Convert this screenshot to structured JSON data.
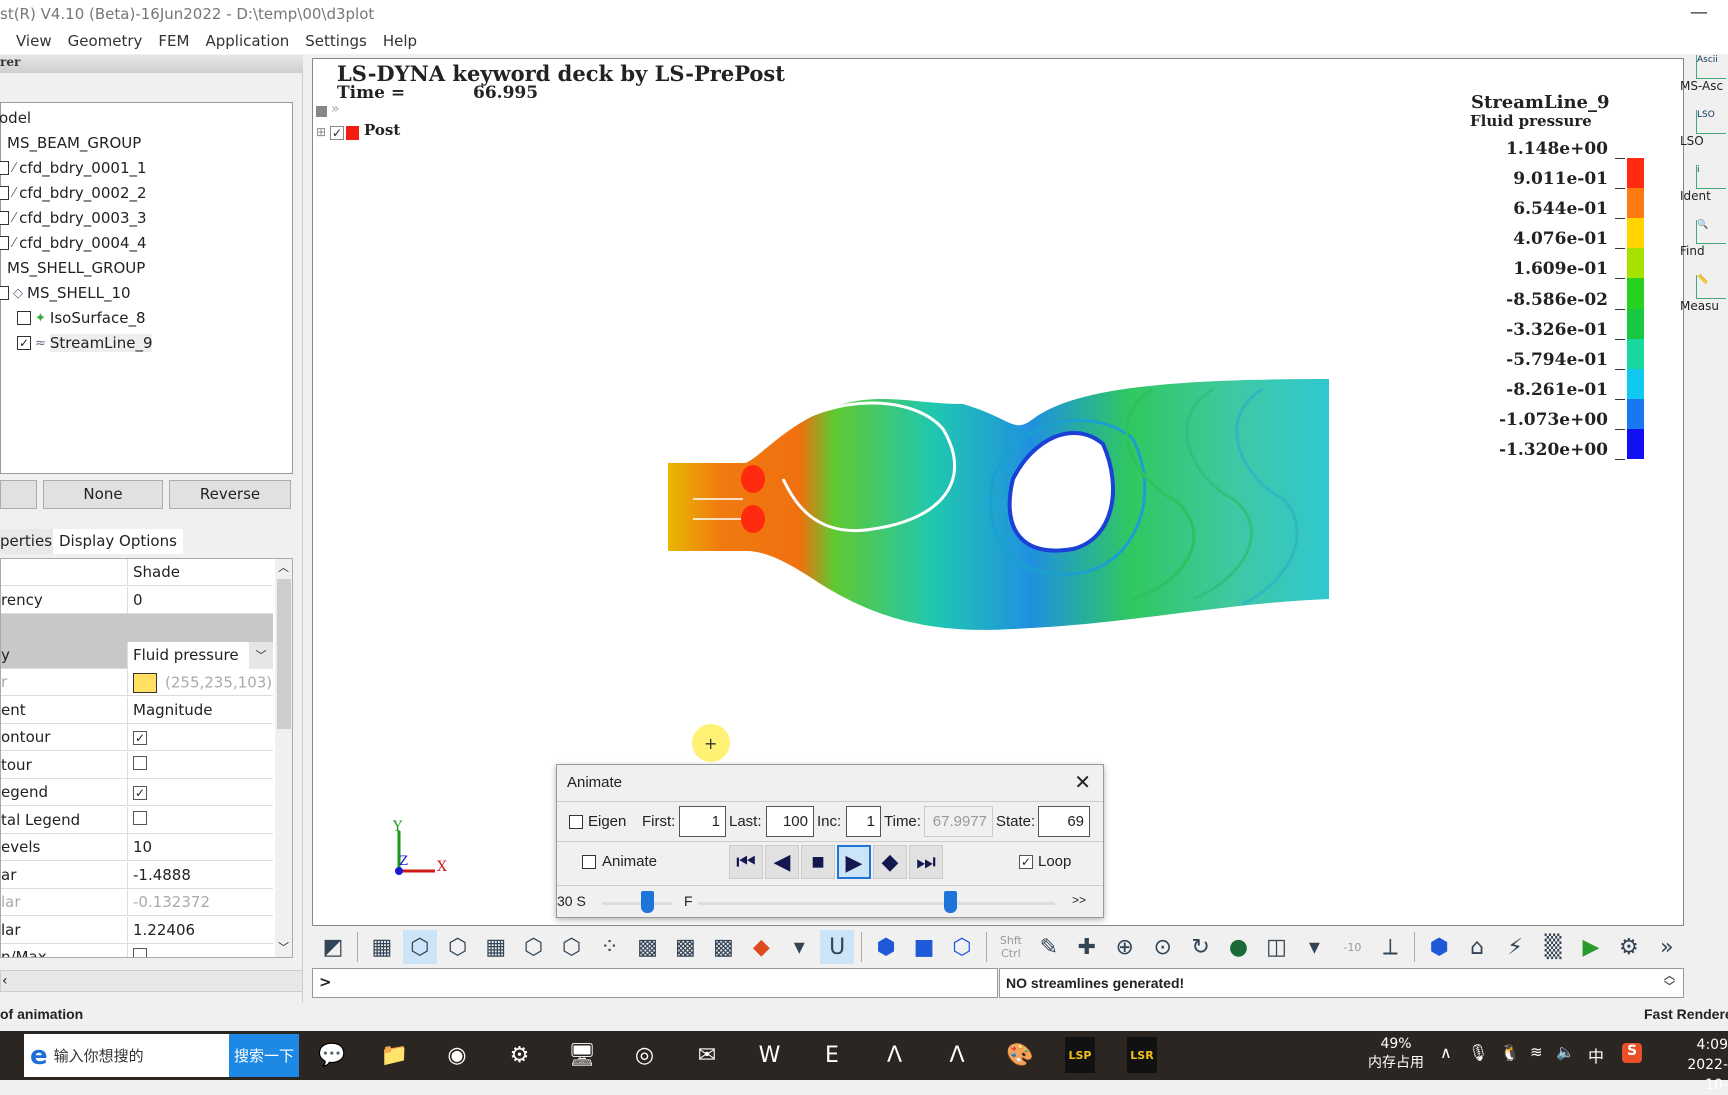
{
  "window": {
    "title": "st(R) V4.10 (Beta)-16Jun2022 - D:\\temp\\00\\d3plot",
    "minimize": "—"
  },
  "menu": [
    "View",
    "Geometry",
    "FEM",
    "Application",
    "Settings",
    "Help"
  ],
  "left_panel": {
    "header": "rer",
    "tree": [
      {
        "label": "odel",
        "indent": 0,
        "check": null,
        "icon": ""
      },
      {
        "label": "MS_BEAM_GROUP",
        "indent": 1,
        "check": null,
        "icon": ""
      },
      {
        "label": "cfd_bdry_0001_1",
        "indent": 1,
        "check": false,
        "icon": "line-icon"
      },
      {
        "label": "cfd_bdry_0002_2",
        "indent": 1,
        "check": false,
        "icon": "line-icon"
      },
      {
        "label": "cfd_bdry_0003_3",
        "indent": 1,
        "check": false,
        "icon": "line-icon"
      },
      {
        "label": "cfd_bdry_0004_4",
        "indent": 1,
        "check": false,
        "icon": "line-icon"
      },
      {
        "label": "MS_SHELL_GROUP",
        "indent": 1,
        "check": null,
        "icon": ""
      },
      {
        "label": "MS_SHELL_10",
        "indent": 1,
        "check": false,
        "icon": "shell-icon"
      },
      {
        "label": "IsoSurface_8",
        "indent": 2,
        "check": false,
        "icon": "isosurface-icon"
      },
      {
        "label": "StreamLine_9",
        "indent": 2,
        "check": true,
        "icon": "streamline-icon"
      }
    ],
    "buttons": [
      "",
      "None",
      "Reverse"
    ],
    "tabs": [
      "perties",
      "Display Options"
    ],
    "properties": [
      {
        "label": "",
        "value": "Shade"
      },
      {
        "label": "rency",
        "value": "0"
      },
      {
        "label": "",
        "value": "",
        "section": true
      },
      {
        "label": "y",
        "value": "Fluid pressure",
        "dropdown": true
      },
      {
        "label": "r",
        "value": "(255,235,103)",
        "swatch": "#ffe060",
        "muted": true
      },
      {
        "label": "ent",
        "value": "Magnitude"
      },
      {
        "label": "ontour",
        "checkbox": true
      },
      {
        "label": "tour",
        "checkbox": false
      },
      {
        "label": "egend",
        "checkbox": true
      },
      {
        "label": "tal Legend",
        "checkbox": false
      },
      {
        "label": "evels",
        "value": "10"
      },
      {
        "label": "ar",
        "value": "-1.4888"
      },
      {
        "label": "lar",
        "value": "-0.132372",
        "muted": true
      },
      {
        "label": "lar",
        "value": "1.22406"
      },
      {
        "label": "n/Max",
        "checkbox": false
      }
    ]
  },
  "viewport": {
    "title": "LS-DYNA keyword deck by LS-PrePost",
    "time_label": "Time =",
    "time_value": "66.995",
    "post_label": "Post",
    "legend": {
      "title": "StreamLine_9",
      "subtitle": "Fluid pressure",
      "values": [
        "1.148e+00",
        "9.011e-01",
        "6.544e-01",
        "4.076e-01",
        "1.609e-01",
        "-8.586e-02",
        "-3.326e-01",
        "-5.794e-01",
        "-8.261e-01",
        "-1.073e+00",
        "-1.320e+00"
      ],
      "colors": [
        "#ff2a10",
        "#ff7a10",
        "#ffd400",
        "#a8e000",
        "#28d020",
        "#18c840",
        "#18d8a0",
        "#10c8f0",
        "#1878f0",
        "#1010f0"
      ]
    },
    "axes": {
      "x": "X",
      "y": "Y",
      "z": "Z"
    }
  },
  "right_panel": [
    {
      "label": "MS-Asc",
      "icon": "ascii-plot-icon",
      "glyph": "Ascii"
    },
    {
      "label": "LSO",
      "icon": "lso-plot-icon",
      "glyph": "LSO"
    },
    {
      "label": "Ident",
      "icon": "identify-icon",
      "glyph": "i"
    },
    {
      "label": "Find",
      "icon": "find-icon",
      "glyph": "🔍"
    },
    {
      "label": "Measu",
      "icon": "measure-icon",
      "glyph": "📏"
    }
  ],
  "toolbar": [
    {
      "icon": "fringe-toggle-icon",
      "glyph": "◩"
    },
    {
      "sep": true
    },
    {
      "icon": "wireframe-cube-icon",
      "glyph": "▦"
    },
    {
      "icon": "shaded-cube-icon",
      "glyph": "⬡",
      "sel": true
    },
    {
      "icon": "hidden-line-cube-icon",
      "glyph": "⬡"
    },
    {
      "icon": "mesh-cube-icon",
      "glyph": "▦"
    },
    {
      "icon": "feature-line-icon",
      "glyph": "⬡"
    },
    {
      "icon": "outline-cube-icon",
      "glyph": "⬡"
    },
    {
      "icon": "points-cube-icon",
      "glyph": "⁘"
    },
    {
      "icon": "shrink-cube-icon",
      "glyph": "▩"
    },
    {
      "icon": "exploded-cube-icon",
      "glyph": "▩"
    },
    {
      "icon": "transparent-cube-icon",
      "glyph": "▩"
    },
    {
      "icon": "fringe-icon",
      "glyph": "◆"
    },
    {
      "icon": "dropdown-arrow-icon",
      "glyph": "▾"
    },
    {
      "icon": "undeformed-icon",
      "glyph": "U",
      "sel": true
    },
    {
      "sep": true
    },
    {
      "icon": "solid-view-icon",
      "glyph": "⬢"
    },
    {
      "icon": "shaded-view-icon",
      "glyph": "■"
    },
    {
      "icon": "wire-view-icon",
      "glyph": "⬡"
    },
    {
      "sep": true
    },
    {
      "icon": "shift-ctrl-icon",
      "glyph": "Shft Ctrl"
    },
    {
      "icon": "eraser-icon",
      "glyph": "✎"
    },
    {
      "icon": "pick-center-icon",
      "glyph": "✚"
    },
    {
      "icon": "zoom-in-icon",
      "glyph": "⊕"
    },
    {
      "icon": "zoom-fit-icon",
      "glyph": "⊙"
    },
    {
      "icon": "rotate-icon",
      "glyph": "↻"
    },
    {
      "icon": "globe-icon",
      "glyph": "●"
    },
    {
      "icon": "projection-box-icon",
      "glyph": "◫"
    },
    {
      "icon": "dropdown-arrow-icon",
      "glyph": "▾"
    },
    {
      "icon": "angle-value-icon",
      "glyph": "-10"
    },
    {
      "icon": "axes-icon",
      "glyph": "⟂"
    },
    {
      "sep": true
    },
    {
      "icon": "view-cube-icon",
      "glyph": "⬢"
    },
    {
      "icon": "home-icon",
      "glyph": "⌂"
    },
    {
      "icon": "render-icon",
      "glyph": "⚡"
    },
    {
      "icon": "checker-icon",
      "glyph": "▒"
    },
    {
      "icon": "play-icon",
      "glyph": "▶"
    },
    {
      "icon": "settings-gears-icon",
      "glyph": "⚙"
    },
    {
      "icon": "more-icon",
      "glyph": "»"
    }
  ],
  "command": {
    "prompt": ">",
    "message": "NO streamlines generated!"
  },
  "status": {
    "left": "of animation",
    "right": "Fast Renderer"
  },
  "animate": {
    "title": "Animate",
    "eigen_label": "Eigen",
    "eigen": false,
    "first_label": "First:",
    "first": "1",
    "last_label": "Last:",
    "last": "100",
    "inc_label": "Inc:",
    "inc": "1",
    "time_label": "Time:",
    "time": "67.9977",
    "state_label": "State:",
    "state": "69",
    "animate_label": "Animate",
    "animate": false,
    "loop_label": "Loop",
    "loop": true,
    "speed_label": "30 S",
    "f_label": "F",
    "more": ">>",
    "speed_slider": 0.18,
    "frame_slider": 0.69
  },
  "taskbar": {
    "search_placeholder": "输入你想搜的",
    "search_button": "搜索一下",
    "apps": [
      {
        "icon": "wechat-icon",
        "glyph": "💬"
      },
      {
        "icon": "file-explorer-icon",
        "glyph": "📁"
      },
      {
        "icon": "chrome-icon",
        "glyph": "◉"
      },
      {
        "icon": "app-icon",
        "glyph": "⚙"
      },
      {
        "icon": "monitor-icon",
        "glyph": "🖥"
      },
      {
        "icon": "browser-icon",
        "glyph": "◎"
      },
      {
        "icon": "mail-icon",
        "glyph": "✉"
      },
      {
        "icon": "wps-icon",
        "glyph": "W"
      },
      {
        "icon": "e-icon",
        "glyph": "E"
      },
      {
        "icon": "a-app-icon",
        "glyph": "Λ"
      },
      {
        "icon": "a-app-2-icon",
        "glyph": "Λ"
      },
      {
        "icon": "paint-icon",
        "glyph": "🎨"
      },
      {
        "icon": "lsp-icon",
        "glyph": "LSP"
      },
      {
        "icon": "lsr-icon",
        "glyph": "LSR"
      }
    ],
    "memory": "49%",
    "memory_label": "内存占用",
    "ime": "中",
    "time": "4:09",
    "date": "2022-10-"
  }
}
